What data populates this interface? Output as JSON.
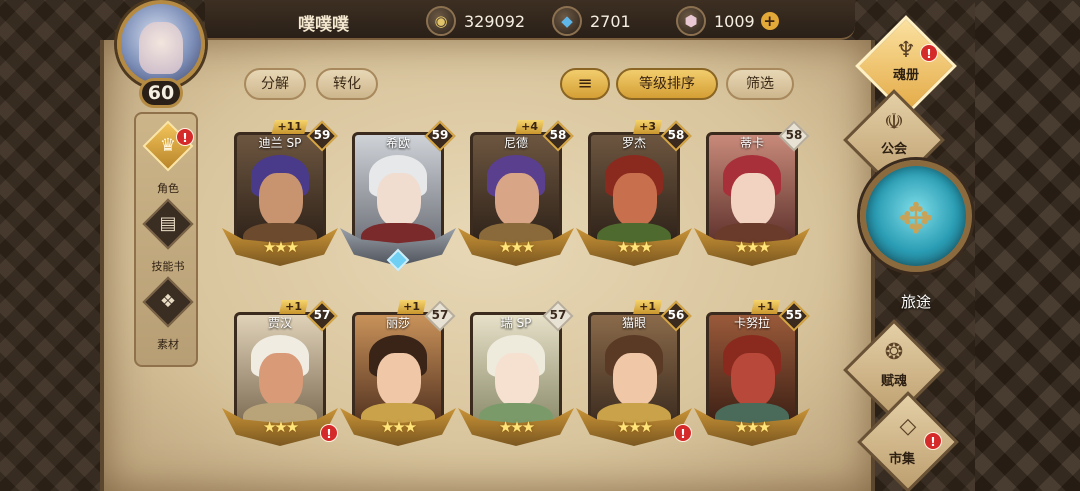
{
  "player": {
    "name": "噗噗噗",
    "level": "60"
  },
  "currencies": [
    {
      "icon": "gold-coin-icon",
      "value": "329092"
    },
    {
      "icon": "blue-crystal-icon",
      "value": "2701"
    },
    {
      "icon": "pink-gem-icon",
      "value": "1009"
    }
  ],
  "sidebar": {
    "items": [
      {
        "label": "角色",
        "icon": "character-icon",
        "active": true,
        "alert": "!"
      },
      {
        "label": "技能书",
        "icon": "skill-book-icon",
        "active": false
      },
      {
        "label": "素材",
        "icon": "material-icon",
        "active": false
      }
    ]
  },
  "toolbar": {
    "decompose": "分解",
    "convert": "转化",
    "sort_by_level": "等级排序",
    "filter": "筛选"
  },
  "heroes": [
    {
      "name": "迪兰 SP",
      "level": "59",
      "plus": "+11",
      "stars": "★★★",
      "theme": "dark"
    },
    {
      "name": "希欧",
      "level": "59",
      "plus": "",
      "stars": "",
      "theme": "dark",
      "gem": true
    },
    {
      "name": "尼德",
      "level": "58",
      "plus": "+4",
      "stars": "★★★",
      "theme": "dark"
    },
    {
      "name": "罗杰",
      "level": "58",
      "plus": "+3",
      "stars": "★★★",
      "theme": "dark"
    },
    {
      "name": "蒂卡",
      "level": "58",
      "plus": "",
      "stars": "★★★",
      "theme": "light"
    },
    {
      "name": "贾汉",
      "level": "57",
      "plus": "+1",
      "stars": "★★★",
      "theme": "dark",
      "alert": "!"
    },
    {
      "name": "丽莎",
      "level": "57",
      "plus": "+1",
      "stars": "★★★",
      "theme": "light"
    },
    {
      "name": "瑞 SP",
      "level": "57",
      "plus": "",
      "stars": "★★★",
      "theme": "light"
    },
    {
      "name": "猫眼",
      "level": "56",
      "plus": "+1",
      "stars": "★★★",
      "theme": "dark",
      "alert": "!"
    },
    {
      "name": "卡努拉",
      "level": "55",
      "plus": "+1",
      "stars": "★★★",
      "theme": "dark"
    }
  ],
  "right_nav": {
    "soul_book": "魂册",
    "guild": "公会",
    "journey": "旅途",
    "soul_gift": "赋魂",
    "market": "市集",
    "alert": "!"
  },
  "colors": {
    "gold_accent": "#e2a838",
    "alert_red": "#d42a2a",
    "parchment": "#e8d8b6",
    "frame_dark": "#3a2c1f"
  }
}
